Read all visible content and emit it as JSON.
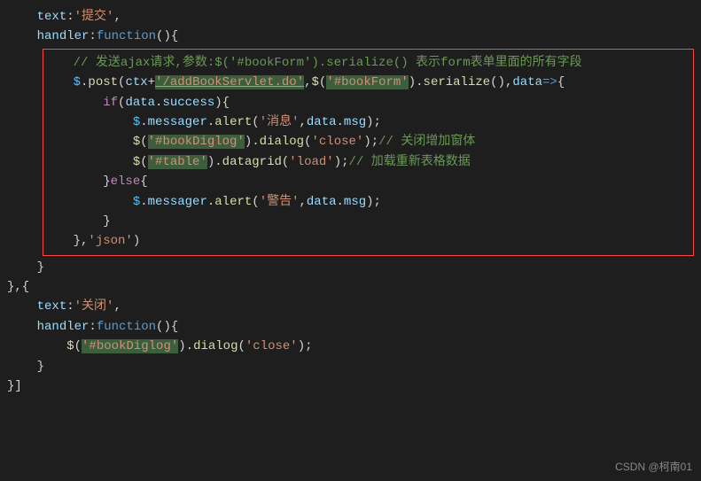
{
  "code": {
    "l1_prop": "text",
    "l1_val": "'提交'",
    "l2_prop": "handler",
    "l2_kw": "function",
    "l3_comment": "// 发送ajax请求,参数:$('#bookForm').serialize() 表示form表单里面的所有字段",
    "l4_obj": "$",
    "l4_method": "post",
    "l4_ctx": "ctx",
    "l4_url": "'/addBookServlet.do'",
    "l4_sel": "'#bookForm'",
    "l4_ser": "serialize",
    "l4_data": "data",
    "l5_if": "if",
    "l5_data": "data",
    "l5_success": "success",
    "l6_msgr": "messager",
    "l6_alert": "alert",
    "l6_msg1": "'消息'",
    "l6_data": "data",
    "l6_msg": "msg",
    "l7_sel": "'#bookDiglog'",
    "l7_dialog": "dialog",
    "l7_close": "'close'",
    "l7_comment": "// 关闭增加窗体",
    "l8_sel": "'#table'",
    "l8_grid": "datagrid",
    "l8_load": "'load'",
    "l8_comment": "// 加载重新表格数据",
    "l9_else": "else",
    "l10_warn": "'警告'",
    "l12_json": "'json'",
    "l15_close_val": "'关闭'",
    "l17_sel": "'#bookDiglog'",
    "l17_close": "'close'"
  },
  "watermark": "CSDN @柯南01"
}
